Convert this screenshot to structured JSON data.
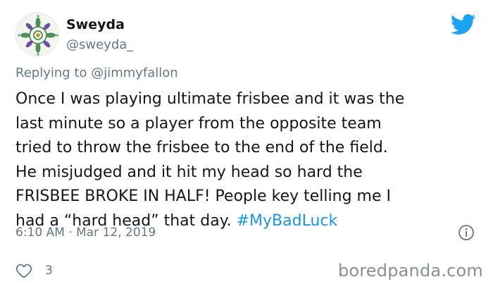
{
  "user": {
    "display_name": "Sweyda",
    "handle": "@sweyda_"
  },
  "reply": {
    "prefix": "Replying to ",
    "mention": "@jimmyfallon"
  },
  "tweet": {
    "lines": [
      "Once I was playing ultimate frisbee and it was the",
      "last minute so a player from the opposite team",
      "tried to throw the frisbee to the end of the field.",
      "He misjudged and it hit my head so hard the",
      "FRISBEE BROKE IN HALF! People key telling me I",
      "had a “hard head” that day. "
    ],
    "hashtag": "#MyBadLuck"
  },
  "meta": {
    "timestamp": "6:10 AM · Mar 12, 2019"
  },
  "engagement": {
    "like_count": "3"
  },
  "watermark": "boredpanda.com",
  "colors": {
    "twitter_blue": "#1da1f2",
    "hashtag": "#1b95e0",
    "secondary_text": "#657786"
  },
  "icons": {
    "brand": "twitter-bird-icon",
    "info": "info-icon",
    "like": "heart-icon"
  }
}
